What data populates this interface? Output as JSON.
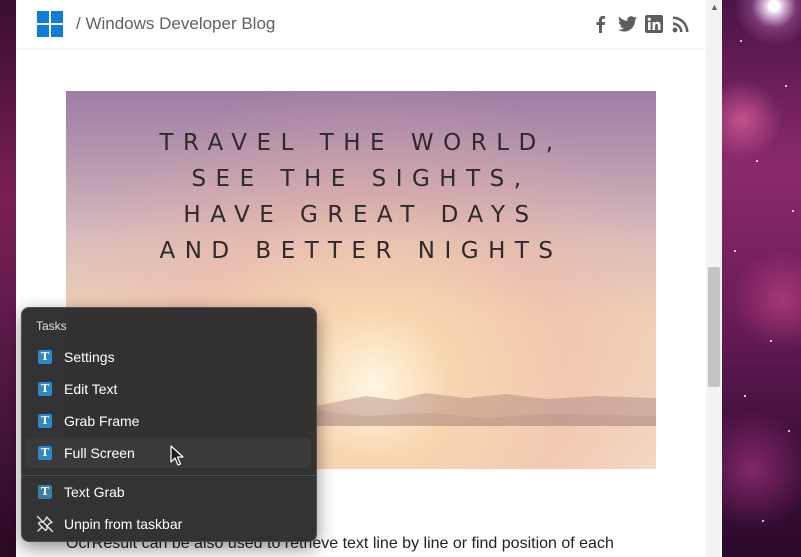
{
  "site": {
    "breadcrumb": "/ Windows Developer Blog",
    "social": [
      "facebook-icon",
      "twitter-icon",
      "linkedin-icon",
      "rss-icon"
    ]
  },
  "hero": {
    "lines": [
      "TRAVEL THE WORLD,",
      "SEE THE SIGHTS,",
      "HAVE GREAT DAYS",
      "AND BETTER NIGHTS"
    ]
  },
  "article": {
    "text": "OcrResult can be also used to retrieve text line by line or find position of each"
  },
  "jumplist": {
    "section_title": "Tasks",
    "items": [
      {
        "label": "Settings",
        "icon": "text-grab-icon"
      },
      {
        "label": "Edit Text",
        "icon": "text-grab-icon"
      },
      {
        "label": "Grab Frame",
        "icon": "text-grab-icon"
      },
      {
        "label": "Full Screen",
        "icon": "text-grab-icon",
        "hovered": true
      }
    ],
    "app_item": {
      "label": "Text Grab",
      "icon": "text-grab-icon"
    },
    "unpin": {
      "label": "Unpin from taskbar",
      "icon": "unpin-icon"
    }
  },
  "colors": {
    "accent": "#0f7cd8",
    "menu_bg": "#2c2c2c",
    "menu_hover": "#3a3a3a"
  }
}
